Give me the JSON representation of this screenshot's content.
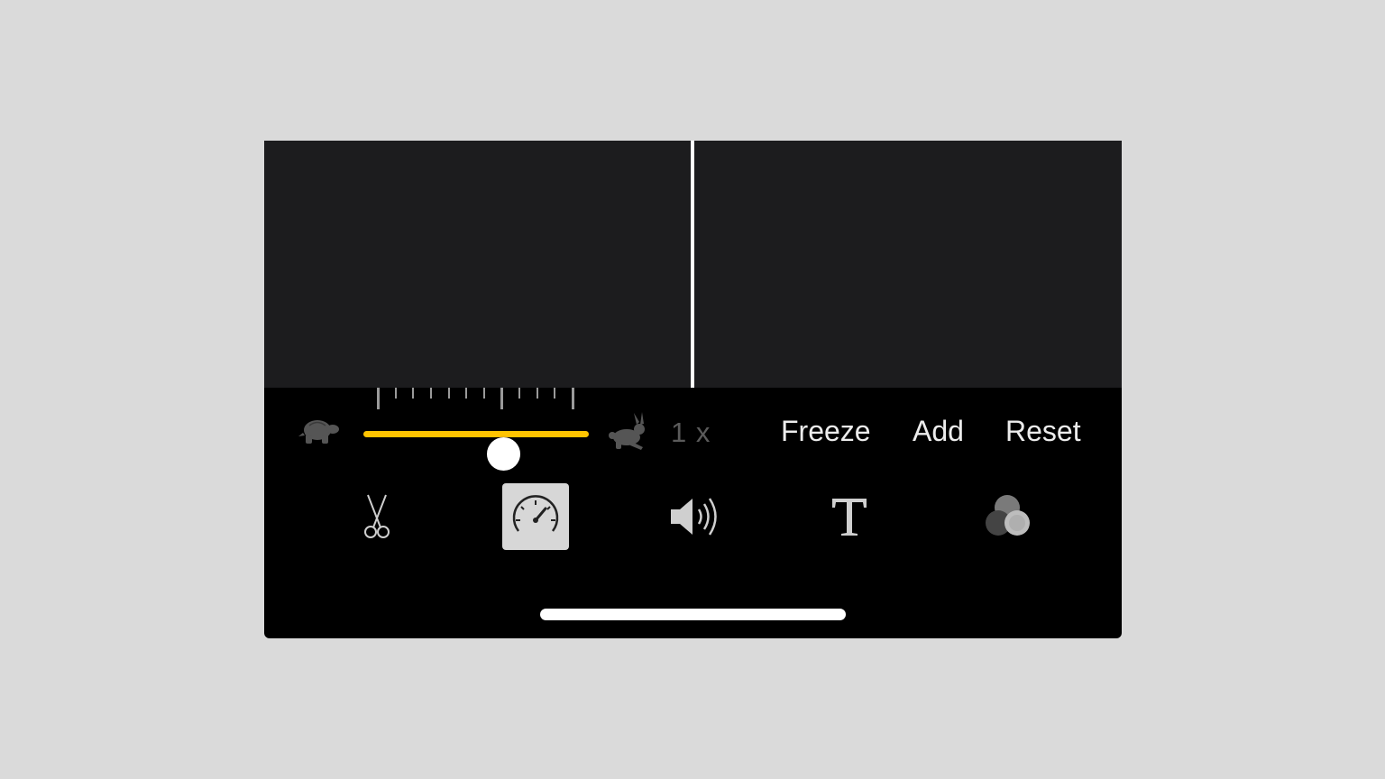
{
  "speed": {
    "value_label": "1 x",
    "slider_fraction": 0.62,
    "slow_icon": "turtle-icon",
    "fast_icon": "rabbit-icon"
  },
  "actions": {
    "freeze": "Freeze",
    "add": "Add",
    "reset": "Reset"
  },
  "tools": [
    {
      "icon": "scissors-icon",
      "active": false
    },
    {
      "icon": "speedometer-icon",
      "active": true
    },
    {
      "icon": "volume-icon",
      "active": false
    },
    {
      "icon": "text-icon",
      "active": false
    },
    {
      "icon": "filters-icon",
      "active": false
    }
  ],
  "colors": {
    "slider_accent": "#ffc400",
    "active_tool_bg": "#d7d7d7",
    "timeline_bg": "#1c1c1e"
  }
}
